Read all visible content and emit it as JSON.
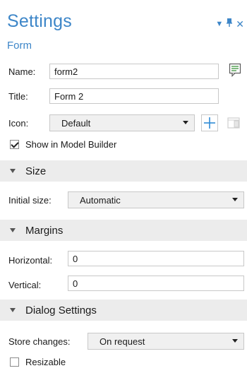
{
  "panel": {
    "title": "Settings",
    "subtitle": "Form"
  },
  "window_icons": [
    "dropdown-arrow-icon",
    "pin-icon",
    "close-icon"
  ],
  "fields": {
    "name": {
      "label": "Name:",
      "value": "form2"
    },
    "title": {
      "label": "Title:",
      "value": "Form 2"
    },
    "icon": {
      "label": "Icon:",
      "value": "Default"
    }
  },
  "show_in_model_builder": {
    "label": "Show in Model Builder",
    "checked": true
  },
  "sections": {
    "size": {
      "label": "Size",
      "initial_size": {
        "label": "Initial size:",
        "value": "Automatic"
      }
    },
    "margins": {
      "label": "Margins",
      "horizontal": {
        "label": "Horizontal:",
        "value": "0"
      },
      "vertical": {
        "label": "Vertical:",
        "value": "0"
      }
    },
    "dialog_settings": {
      "label": "Dialog Settings",
      "store_changes": {
        "label": "Store changes:",
        "value": "On request"
      },
      "resizable": {
        "label": "Resizable",
        "checked": false
      }
    }
  },
  "colors": {
    "accent": "#3d86c8",
    "section_bg": "#ececec",
    "add_icon": "#2e8bd6"
  }
}
